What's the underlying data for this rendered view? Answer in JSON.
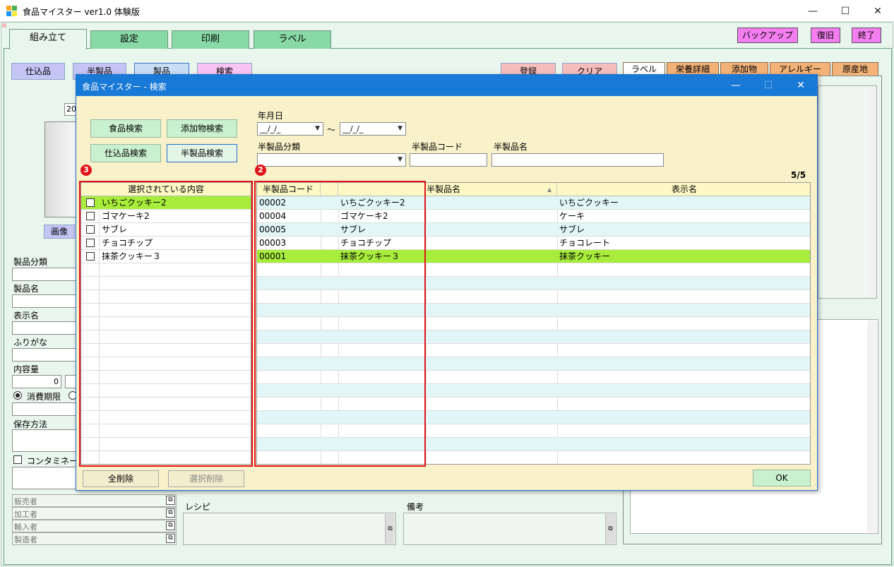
{
  "window": {
    "title": "食品マイスター ver1.0 体験版",
    "minimize": "—",
    "maximize": "☐",
    "close": "✕"
  },
  "main_tabs": [
    {
      "label": "組み立て",
      "active": true
    },
    {
      "label": "設定",
      "active": false
    },
    {
      "label": "印刷",
      "active": false
    },
    {
      "label": "ラベル",
      "active": false
    }
  ],
  "top_buttons": {
    "backup": "バックアップ",
    "restore": "復旧",
    "exit": "終了"
  },
  "section_buttons": {
    "prep": "仕込品",
    "semi": "半製品",
    "product": "製品",
    "search": "検索"
  },
  "action_buttons": {
    "register": "登録",
    "clear": "クリア"
  },
  "right_tabs": [
    {
      "label": "ラベル",
      "active": true
    },
    {
      "label": "栄養詳細",
      "active": false
    },
    {
      "label": "添加物",
      "active": false
    },
    {
      "label": "アレルギー",
      "active": false
    },
    {
      "label": "原産地",
      "active": false
    }
  ],
  "left_form": {
    "date_partial": "20",
    "image_button": "画像",
    "product_category_label": "製品分類",
    "product_name_label": "製品名",
    "display_name_label": "表示名",
    "furigana_label": "ふりがな",
    "content_label": "内容量",
    "content_value": "0",
    "expiry_radio_label": "消費期限",
    "storage_label": "保存方法",
    "contamination_label": "コンタミネーシ",
    "seller_label": "販売者",
    "processor_label": "加工者",
    "importer_label": "輸入者",
    "manufacturer_label": "製造者",
    "recipe_label": "レシピ",
    "notes_label": "備考"
  },
  "dialog": {
    "title": "食品マイスター - 検索",
    "search_buttons": {
      "food": "食品検索",
      "additive": "添加物検索",
      "prep": "仕込品検索",
      "semi": "半製品検索"
    },
    "date_label": "年月日",
    "date_from": "__/_/_",
    "date_to": "__/_/_",
    "tilde": "〜",
    "category_label": "半製品分類",
    "code_label": "半製品コード",
    "name_label": "半製品名",
    "count": "5/5",
    "badge_left": "3",
    "badge_right": "2",
    "selected_header": "選択されている内容",
    "selected_items": [
      {
        "label": "いちごクッキー2",
        "selected": true
      },
      {
        "label": "ゴマケーキ2",
        "selected": false
      },
      {
        "label": "サブレ",
        "selected": false
      },
      {
        "label": "チョコチップ",
        "selected": false
      },
      {
        "label": "抹茶クッキー３",
        "selected": false
      }
    ],
    "results_headers": [
      "半製品コード",
      "半製品名",
      "表示名"
    ],
    "sort_indicator": "▲",
    "results": [
      {
        "code": "00002",
        "name": "いちごクッキー2",
        "display": "いちごクッキー",
        "selected": false
      },
      {
        "code": "00004",
        "name": "ゴマケーキ2",
        "display": "ケーキ",
        "selected": false
      },
      {
        "code": "00005",
        "name": "サブレ",
        "display": "サブレ",
        "selected": false
      },
      {
        "code": "00003",
        "name": "チョコチップ",
        "display": "チョコレート",
        "selected": false
      },
      {
        "code": "00001",
        "name": "抹茶クッキー３",
        "display": "抹茶クッキー",
        "selected": true
      }
    ],
    "delete_all": "全削除",
    "delete_selected": "選択削除",
    "ok": "OK"
  },
  "colors": {
    "accent": "#1979d6",
    "tab_green": "#88d9a5",
    "pink_button": "#f47ef0",
    "selected_row": "#a8ec3c",
    "highlight_box": "#e0141a",
    "dialog_bg": "#f8f1c9"
  }
}
